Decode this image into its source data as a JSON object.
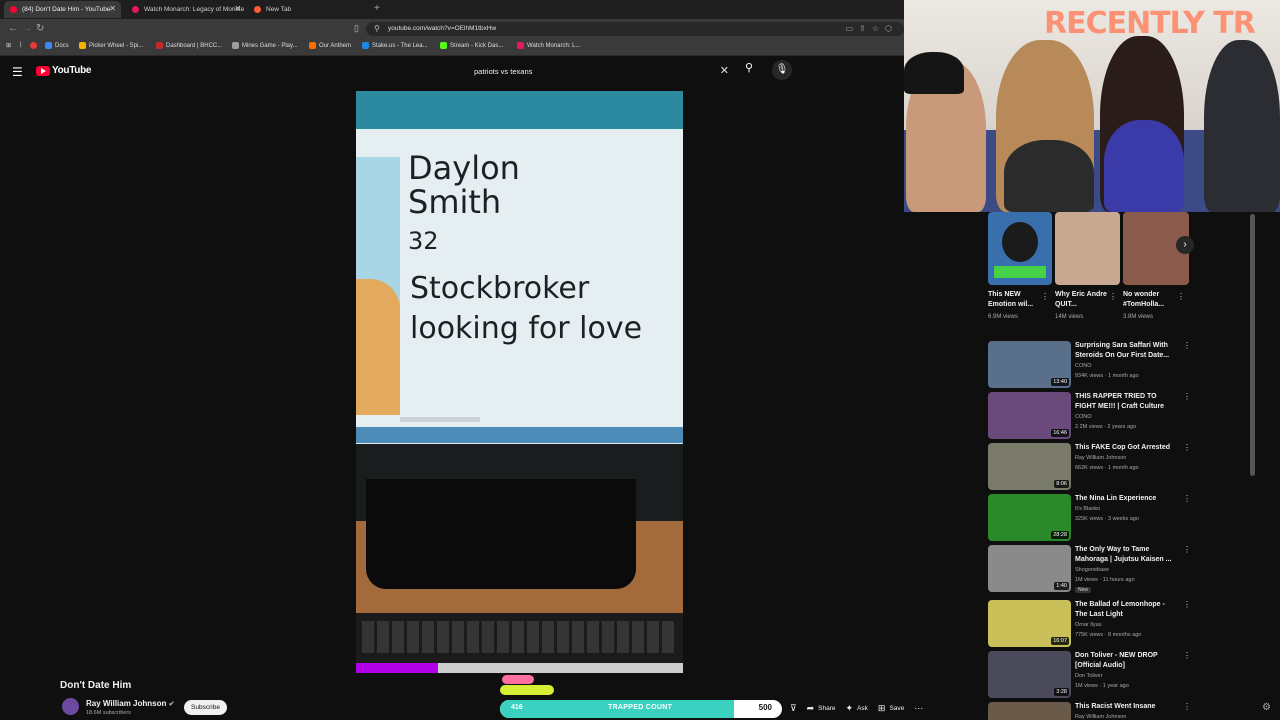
{
  "browser": {
    "tabs": [
      {
        "label": "(84) Don't Date Him - YouTube",
        "color": "#ff0033"
      },
      {
        "label": "Watch Monarch: Legacy of Monste",
        "color": "#e8175d"
      },
      {
        "label": "New Tab",
        "color": "#ff5c35"
      }
    ],
    "url": "youtube.com/watch?v=OElhM1tbxHw",
    "bookmarks": [
      {
        "label": "Docs",
        "color": "#4285f4"
      },
      {
        "label": "Picker Wheel - Spi...",
        "color": "#f4b400"
      },
      {
        "label": "Dashboard | BHCC...",
        "color": "#c62828"
      },
      {
        "label": "Mines Game - Play...",
        "color": "#9e9e9e"
      },
      {
        "label": "Our Anthem",
        "color": "#ff6d00"
      },
      {
        "label": "Stake.us - The Lea...",
        "color": "#1e88e5"
      },
      {
        "label": "Stream - Kick Das...",
        "color": "#53fc18"
      },
      {
        "label": "Watch Monarch: L...",
        "color": "#e8175d"
      }
    ]
  },
  "youtube": {
    "logo": "YouTube",
    "search_query": "patriots vs texans"
  },
  "video": {
    "frame_name": "Daylon\nSmith",
    "frame_age": "32",
    "frame_bio": "Stockbroker\nlooking for love",
    "progress": 0.25,
    "title": "Don't Date Him",
    "channel": "Ray William Johnson",
    "subscribers": "18.6M subscribers",
    "subscribe_label": "Subscribe"
  },
  "overlay": {
    "trapped_count": "416",
    "trapped_label": "TRAPPED COUNT",
    "trapped_goal": "500",
    "trapped_fraction": 0.83,
    "cam_banner": "RECENTLY TR"
  },
  "actions": [
    {
      "label": "",
      "icon": "thumbs-down-icon",
      "glyph": "👎"
    },
    {
      "label": "Share",
      "icon": "share-icon",
      "glyph": "➦"
    },
    {
      "label": "Ask",
      "icon": "sparkle-icon",
      "glyph": "✦"
    },
    {
      "label": "Save",
      "icon": "save-icon",
      "glyph": "⊞"
    },
    {
      "label": "",
      "icon": "more-icon",
      "glyph": "⋯"
    }
  ],
  "shorts": [
    {
      "title": "This NEW Emotion wil...",
      "views": "6.9M views",
      "color": "#3a6fae"
    },
    {
      "title": "Why Eric Andre QUIT...",
      "views": "14M views",
      "color": "#c9a892"
    },
    {
      "title": "No wonder #TomHolla...",
      "views": "3.8M views",
      "color": "#8a5a4a"
    }
  ],
  "recommended": [
    {
      "title": "Surprising Sara Saffari With Steroids On Our First Date...",
      "channel": "CONO",
      "meta": "934K views · 1 month ago",
      "duration": "13:40",
      "color": "#5a6f8a"
    },
    {
      "title": "THIS RAPPER TRIED TO FIGHT ME!!! | Craft Culture",
      "channel": "CONO",
      "meta": "2.2M views · 2 years ago",
      "duration": "16:46",
      "color": "#6a4a7a"
    },
    {
      "title": "This FAKE Cop Got Arrested",
      "channel": "Ray William Johnson",
      "meta": "662K views · 1 month ago",
      "duration": "8:06",
      "color": "#7a7a6a"
    },
    {
      "title": "The Nina Lin Experience",
      "channel": "It's Blanko",
      "meta": "325K views · 3 weeks ago",
      "duration": "28:28",
      "color": "#2a8a2a"
    },
    {
      "title": "The Only Way to Tame Mahoraga | Jujutsu Kaisen ...",
      "channel": "Shogonebase",
      "meta": "1M views · 11 hours ago",
      "duration": "1:40",
      "badge": "New",
      "color": "#8a8a8a"
    },
    {
      "title": "The Ballad of Lemonhope - The Last Light",
      "channel": "Omar Ilyas",
      "meta": "775K views · 8 months ago",
      "duration": "16:07",
      "color": "#c9c05a"
    },
    {
      "title": "Don Toliver - NEW DROP [Official Audio]",
      "channel": "Don Toliver",
      "meta": "1M views · 1 year ago",
      "duration": "3:28",
      "color": "#4a4a5a"
    },
    {
      "title": "This Racist Went Insane",
      "channel": "Ray William Johnson",
      "meta": "",
      "duration": "",
      "color": "#6a5a4a"
    }
  ]
}
